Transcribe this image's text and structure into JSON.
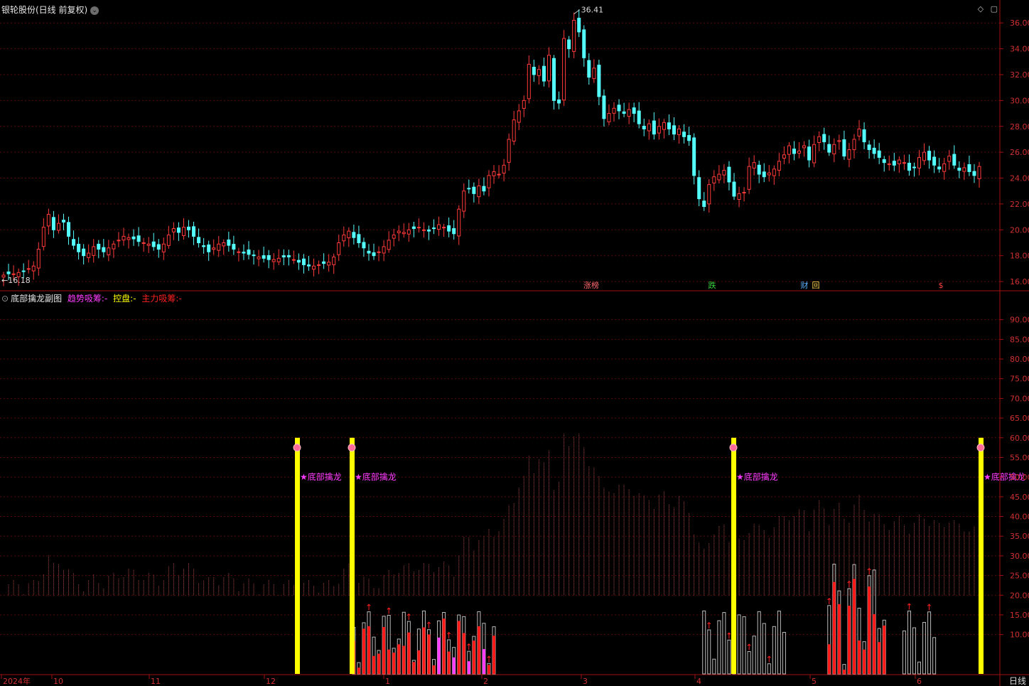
{
  "window": {
    "title": "银轮股份(日线 前复权)",
    "menu_icon": "chevron-down-icon"
  },
  "window_buttons": [
    "◇",
    "▢"
  ],
  "period_button": "日线",
  "indicator": {
    "title": "底部擒龙副图",
    "legend": [
      {
        "name": "趋势吸筹",
        "value": "-",
        "color": "#ff3cff"
      },
      {
        "name": "控盘",
        "value": "-",
        "color": "#ffff00"
      },
      {
        "name": "主力吸筹",
        "value": "-",
        "color": "#ff2020"
      }
    ],
    "signal_label": "★底部擒龙"
  },
  "event_markers": [
    {
      "text": "涨榜",
      "color": "#ff6a6a"
    },
    {
      "text": "跌",
      "color": "#39d339"
    },
    {
      "text": "财",
      "color": "#5ab0ff"
    },
    {
      "text": "回",
      "color": "#ffd24d"
    },
    {
      "text": "$",
      "color": "#ff4040"
    }
  ],
  "x_axis_labels": [
    "2024年",
    "10",
    "11",
    "12",
    "1",
    "2",
    "3",
    "4",
    "5",
    "6"
  ],
  "chart_data": [
    {
      "type": "candlestick",
      "price_axis_ticks": [
        "36.00",
        "34.00",
        "32.00",
        "30.00",
        "28.00",
        "26.00",
        "24.00",
        "22.00",
        "20.00",
        "18.00",
        "16.00"
      ],
      "ylim": [
        15.4,
        37.0
      ],
      "max_label": "36.41",
      "min_label": "16.18",
      "up_color": "#ff3a3a",
      "down_color": "#54ffff",
      "closes": [
        16.5,
        16.6,
        16.6,
        16.7,
        16.8,
        17.0,
        17.2,
        18.5,
        20.2,
        21.2,
        20.0,
        20.5,
        20.6,
        19.5,
        18.8,
        18.3,
        18.0,
        18.2,
        18.7,
        18.5,
        18.3,
        18.6,
        18.9,
        19.2,
        19.5,
        19.4,
        19.3,
        19.1,
        19.0,
        18.9,
        18.7,
        18.5,
        18.9,
        19.6,
        20.1,
        19.8,
        20.2,
        20.0,
        19.5,
        19.0,
        18.7,
        18.3,
        18.6,
        18.9,
        19.0,
        18.8,
        18.5,
        18.3,
        18.2,
        18.1,
        18.0,
        17.9,
        17.8,
        17.7,
        17.7,
        17.8,
        17.9,
        17.9,
        17.7,
        17.5,
        17.3,
        17.2,
        17.2,
        17.3,
        17.4,
        17.5,
        17.9,
        19.0,
        19.6,
        19.9,
        19.4,
        19.0,
        18.6,
        18.2,
        18.0,
        18.3,
        18.7,
        19.2,
        19.6,
        19.9,
        19.8,
        20.0,
        20.1,
        20.2,
        20.0,
        19.9,
        20.1,
        20.4,
        20.2,
        19.9,
        19.7,
        21.6,
        23.0,
        23.2,
        22.8,
        23.4,
        23.0,
        24.2,
        24.5,
        24.3,
        25.0,
        27.0,
        28.5,
        29.2,
        30.0,
        32.8,
        32.0,
        32.4,
        31.5,
        33.5,
        30.0,
        29.8,
        34.8,
        34.0,
        36.2,
        35.3,
        33.3,
        31.8,
        32.5,
        30.3,
        28.6,
        29.0,
        29.4,
        29.2,
        29.0,
        29.3,
        29.0,
        28.2,
        27.8,
        28.2,
        27.4,
        28.0,
        28.3,
        27.8,
        27.4,
        27.8,
        27.2,
        26.9,
        24.2,
        22.4,
        21.8,
        23.5,
        24.1,
        24.3,
        24.6,
        23.7,
        22.6,
        22.8,
        22.9,
        24.9,
        25.2,
        24.3,
        24.1,
        24.4,
        24.7,
        25.3,
        25.8,
        26.5,
        25.9,
        26.1,
        26.5,
        25.4,
        26.6,
        27.2,
        26.8,
        26.0,
        26.6,
        26.9,
        25.7,
        26.2,
        27.0,
        27.8,
        26.8,
        26.2,
        25.9,
        25.6,
        25.2,
        25.1,
        25.0,
        25.4,
        25.2,
        24.6,
        24.8,
        25.6,
        26.0,
        25.4,
        25.0,
        24.7,
        25.1,
        25.7,
        25.0,
        24.6,
        24.8,
        24.5,
        24.2,
        24.9
      ]
    },
    {
      "type": "bar",
      "ylim": [
        0,
        95
      ],
      "axis_ticks": [
        "90.00",
        "85.00",
        "80.00",
        "75.00",
        "70.00",
        "65.00",
        "60.00",
        "55.00",
        "50.00",
        "45.00",
        "40.00",
        "35.00",
        "30.00",
        "25.00",
        "20.00",
        "15.00",
        "10.00"
      ],
      "series": [
        {
          "name": "趋势吸筹",
          "color": "#ff3cff"
        },
        {
          "name": "控盘",
          "color": "#ffff00"
        },
        {
          "name": "主力吸筹",
          "color": "#ff2020"
        }
      ]
    }
  ]
}
